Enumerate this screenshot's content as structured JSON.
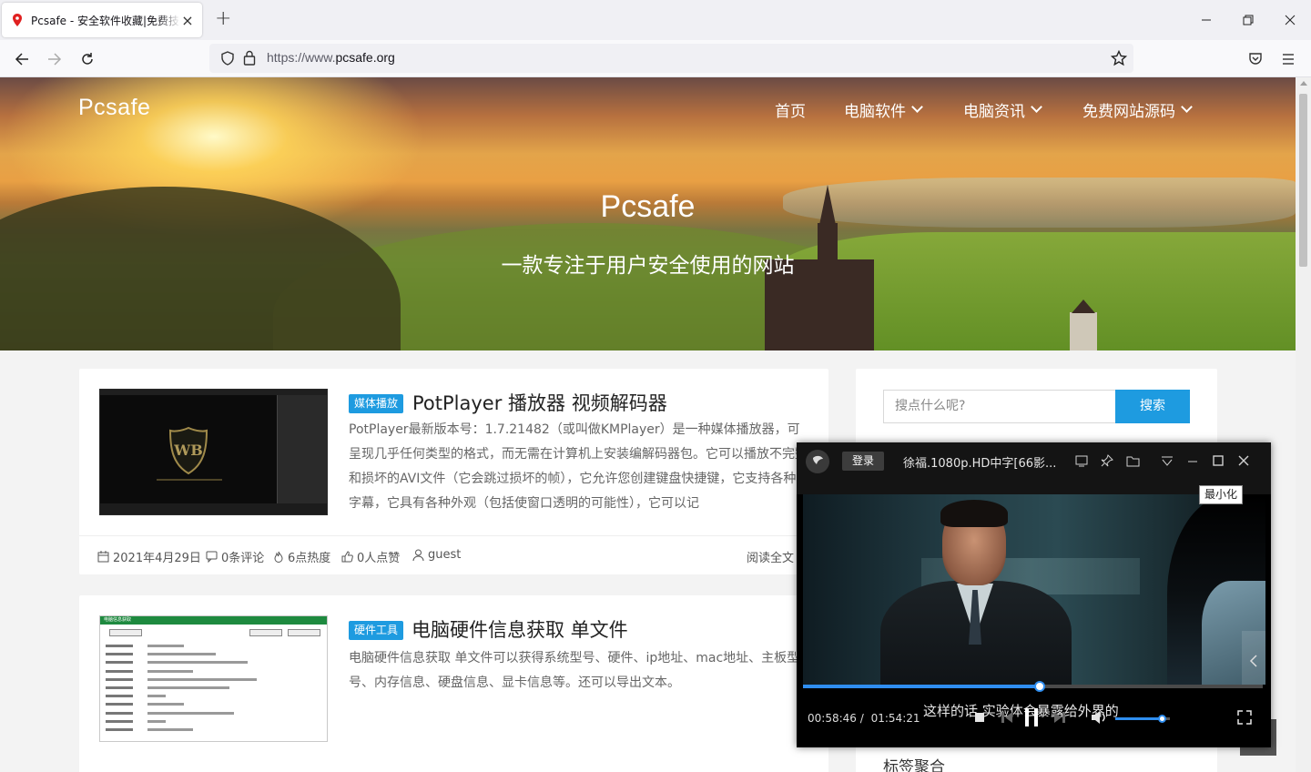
{
  "browser": {
    "tab_title": "Pcsafe - 安全软件收藏|免费技术分享",
    "url_scheme": "https://www.",
    "url_host": "pcsafe.org",
    "new_tab": "+",
    "tab_close": "×"
  },
  "site": {
    "logo": "Pcsafe",
    "nav": [
      {
        "label": "首页",
        "has_dropdown": false
      },
      {
        "label": "电脑软件",
        "has_dropdown": true
      },
      {
        "label": "电脑资讯",
        "has_dropdown": true
      },
      {
        "label": "免费网站源码",
        "has_dropdown": true
      }
    ],
    "hero_title": "Pcsafe",
    "hero_subtitle": "一款专注于用户安全使用的网站"
  },
  "posts": [
    {
      "category": "媒体播放",
      "title": "PotPlayer 播放器 视频解码器",
      "excerpt": "PotPlayer最新版本号：1.7.21482（或叫做KMPlayer）是一种媒体播放器，可呈现几乎任何类型的格式，而无需在计算机上安装编解码器包。它可以播放不完整和损坏的AVI文件（它会跳过损坏的帧），它允许您创建键盘快捷键，它支持各种字幕，它具有各种外观（包括使窗口透明的可能性），它可以记",
      "date": "2021年4月29日",
      "comments": "0条评论",
      "heat": "6点热度",
      "likes": "0人点赞",
      "author": "guest",
      "read_more": "阅读全文"
    },
    {
      "category": "硬件工具",
      "title": "电脑硬件信息获取 单文件",
      "excerpt": "电脑硬件信息获取 单文件可以获得系统型号、硬件、ip地址、mac地址、主板型号、内存信息、硬盘信息、显卡信息等。还可以导出文本。",
      "thumb_title": "电脑信息获取",
      "thumb_rows": [
        "电脑型号：",
        "操作系统：",
        "CPU型号：",
        "内存信息：",
        "硬盘大小：",
        "显卡型号：",
        "网卡：",
        "IP地址：",
        "主板制造商：",
        "主板产品：",
        "主板序列号："
      ]
    }
  ],
  "sidebar": {
    "search_placeholder": "搜点什么呢?",
    "search_button": "搜索",
    "tags_title": "标签聚合"
  },
  "player": {
    "login": "登录",
    "title": "徐福.1080p.HD中字[66影...",
    "tooltip": "最小化",
    "current_time": "00:58:46",
    "separator": "/",
    "total_time": "01:54:21",
    "progress": 0.515,
    "volume": 0.85,
    "subtitle": "这样的话 实验体会暴露给外界的"
  },
  "colors": {
    "accent": "#1e9be0",
    "player_accent": "#2f8ef0"
  }
}
